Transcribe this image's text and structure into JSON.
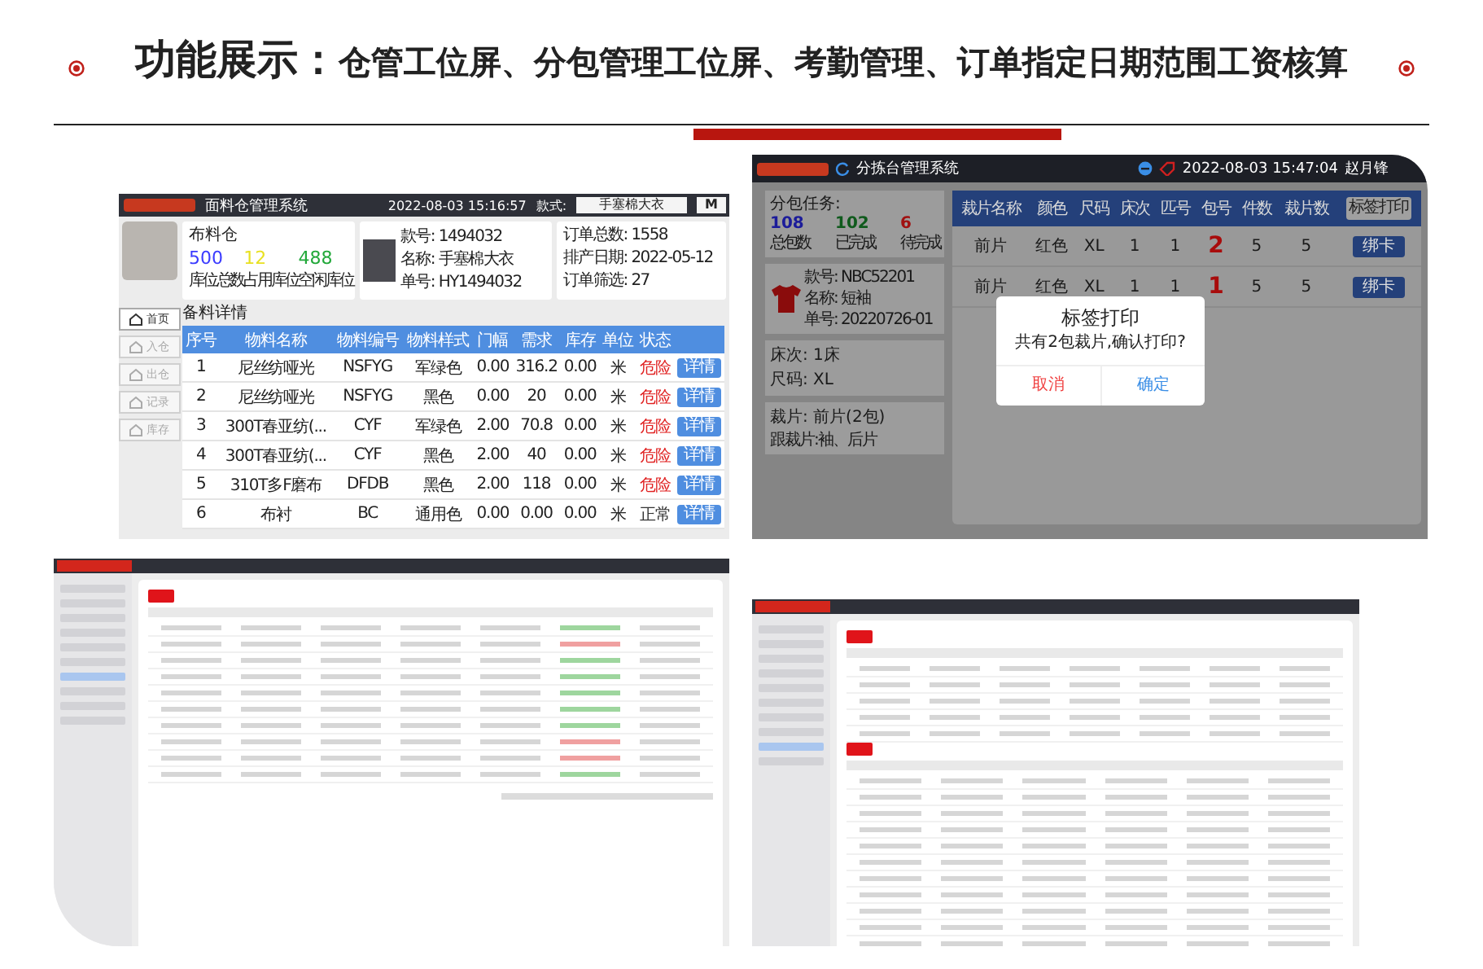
{
  "header": {
    "lead": "功能展示：",
    "title": "仓管工位屏、分包管理工位屏、考勤管理、订单指定日期范围工资核算"
  },
  "panels": [
    {
      "kind": "warehouse",
      "app_title": "面料仓管理系统",
      "datetime": "2022-08-03 15:16:57",
      "style_label": "款式:",
      "style_value": "手塞棉大衣",
      "menu_button": "M",
      "stock": {
        "name": "布料仓",
        "stats": [
          {
            "value": "500",
            "label": "库位总数",
            "color": "#3b3bff"
          },
          {
            "value": "12",
            "label": "占用库位",
            "color": "#e8e020"
          },
          {
            "value": "488",
            "label": "空闲库位",
            "color": "#22a83a"
          }
        ]
      },
      "product": {
        "lines": [
          "款号: 1494032",
          "名称: 手塞棉大衣",
          "单号: HY1494032"
        ]
      },
      "order": {
        "lines": [
          "订单总数: 1558",
          "排产日期: 2022-05-12",
          "订单筛选: 27"
        ]
      },
      "nav": [
        {
          "label": "首页",
          "selected": true
        },
        {
          "label": "入仓",
          "selected": false
        },
        {
          "label": "出仓",
          "selected": false
        },
        {
          "label": "记录",
          "selected": false
        },
        {
          "label": "库存",
          "selected": false
        }
      ],
      "section_title": "备料详情",
      "table": {
        "columns": [
          "序号",
          "物料名称",
          "物料编号",
          "物料样式",
          "门幅",
          "需求",
          "库存",
          "单位",
          "状态"
        ],
        "rows": [
          {
            "cells": [
              "1",
              "尼丝纺哑光",
              "NSFYG",
              "军绿色",
              "0.00",
              "316.2",
              "0.00",
              "米"
            ],
            "status": "危险",
            "alert": true,
            "action": "详情"
          },
          {
            "cells": [
              "2",
              "尼丝纺哑光",
              "NSFYG",
              "黑色",
              "0.00",
              "20",
              "0.00",
              "米"
            ],
            "status": "危险",
            "alert": true,
            "action": "详情"
          },
          {
            "cells": [
              "3",
              "300T春亚纺(...",
              "CYF",
              "军绿色",
              "2.00",
              "70.8",
              "0.00",
              "米"
            ],
            "status": "危险",
            "alert": true,
            "action": "详情"
          },
          {
            "cells": [
              "4",
              "300T春亚纺(...",
              "CYF",
              "黑色",
              "2.00",
              "40",
              "0.00",
              "米"
            ],
            "status": "危险",
            "alert": true,
            "action": "详情"
          },
          {
            "cells": [
              "5",
              "310T多F磨布",
              "DFDB",
              "黑色",
              "2.00",
              "118",
              "0.00",
              "米"
            ],
            "status": "危险",
            "alert": true,
            "action": "详情"
          },
          {
            "cells": [
              "6",
              "布衬",
              "BC",
              "通用色",
              "0.00",
              "0.00",
              "0.00",
              "米"
            ],
            "status": "正常",
            "alert": false,
            "action": "详情"
          }
        ]
      }
    },
    {
      "kind": "sorting",
      "app_title": "分拣台管理系统",
      "datetime": "2022-08-03 15:47:04",
      "user": "赵月锋",
      "task": {
        "title": "分包任务:",
        "stats": [
          {
            "value": "108",
            "label": "总包数",
            "color": "#1c1c9a"
          },
          {
            "value": "102",
            "label": "已完成",
            "color": "#0f5a1c"
          },
          {
            "value": "6",
            "label": "待完成",
            "color": "#a01010"
          }
        ]
      },
      "product": {
        "lines": [
          "款号: NBC52201",
          "名称: 短袖",
          "单号: 20220726-01"
        ]
      },
      "bed": [
        "床次: 1床",
        "尺码: XL"
      ],
      "pieces": {
        "title": "裁片: 前片(2包)",
        "note": "跟裁片:袖、后片"
      },
      "table": {
        "columns": [
          "裁片名称",
          "颜色",
          "尺码",
          "床次",
          "匹号",
          "包号",
          "件数",
          "裁片数"
        ],
        "print_button": "标签打印",
        "rows": [
          {
            "cells": [
              "前片",
              "红色",
              "XL",
              "1",
              "1",
              "2",
              "5",
              "5"
            ],
            "action": "绑卡"
          },
          {
            "cells": [
              "前片",
              "红色",
              "XL",
              "1",
              "1",
              "1",
              "5",
              "5"
            ],
            "action": "绑卡"
          }
        ]
      },
      "dialog": {
        "title": "标签打印",
        "message": "共有2包裁片,确认打印?",
        "cancel": "取消",
        "confirm": "确定"
      }
    },
    {
      "kind": "list-screen"
    },
    {
      "kind": "split-screen"
    }
  ]
}
